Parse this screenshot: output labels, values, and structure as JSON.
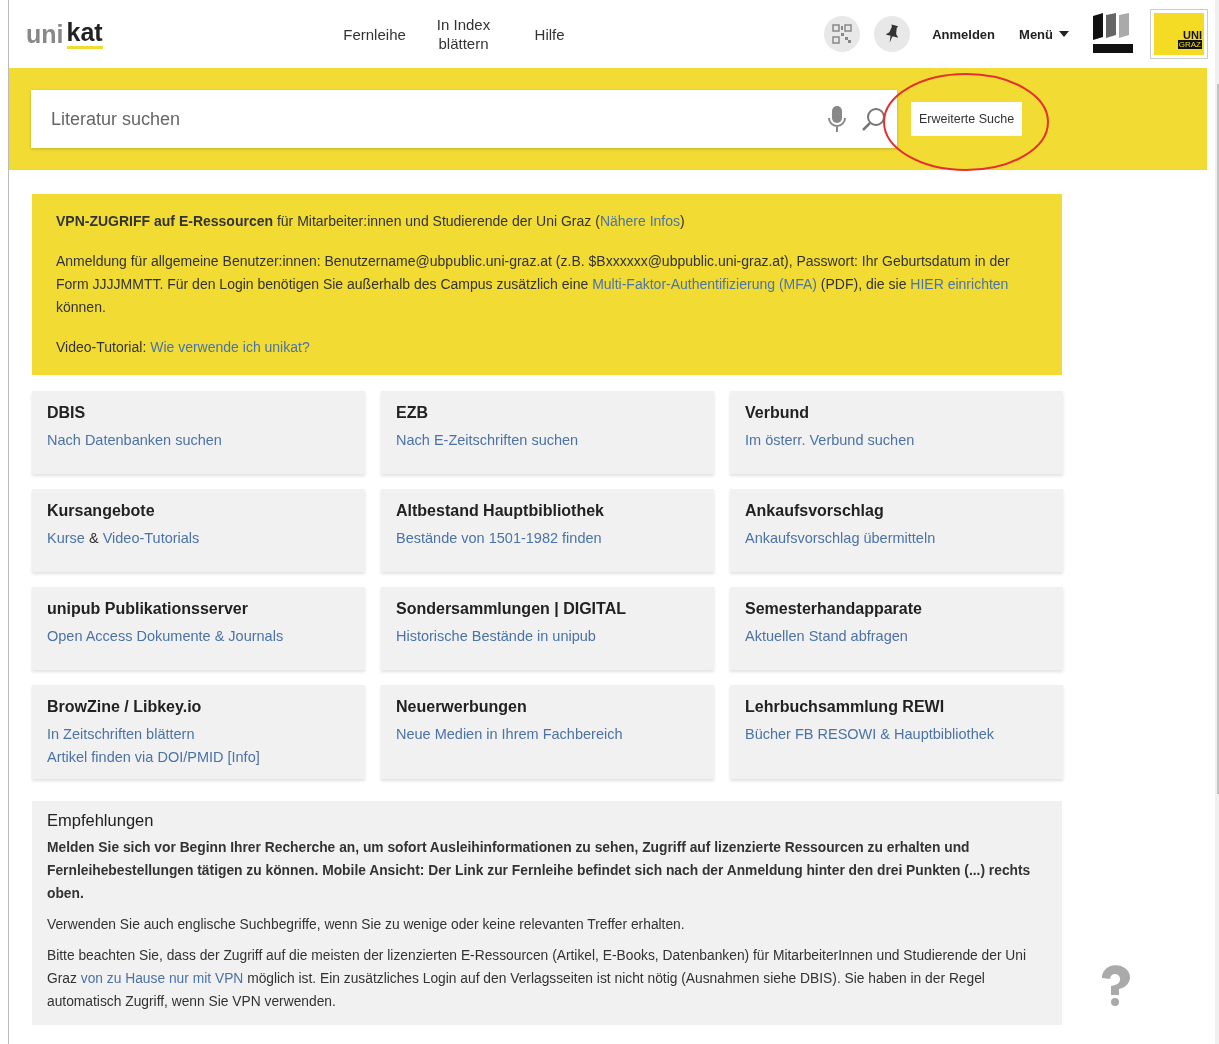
{
  "header": {
    "logo": {
      "first": "uni",
      "second": "kat"
    },
    "nav": [
      "Fernleihe",
      "In Index blättern",
      "Hilfe"
    ],
    "login": "Anmelden",
    "menu": "Menü",
    "uni_logo": {
      "top": "UNI",
      "bottom": "GRAZ"
    }
  },
  "search": {
    "placeholder": "Literatur suchen",
    "advanced": "Erweiterte Suche",
    "advanced_circled": true
  },
  "notice": {
    "paragraphs": [
      [
        {
          "kind": "text",
          "text": "**VPN-ZUGRIFF auf E-Ressourcen** für Mitarbeiter:innen und Studierende der Uni Graz ("
        },
        {
          "kind": "link",
          "text": "Nähere Infos"
        },
        {
          "kind": "text",
          "text": ")"
        }
      ],
      [
        {
          "kind": "text",
          "text": "Anmeldung für allgemeine Benutzer:innen: Benutzername@ubpublic.uni-graz.at (z.B. $Bxxxxxx@ubpublic.uni-graz.at), Passwort: Ihr Geburtsdatum in der Form JJJJMMTT. Für den Login benötigen Sie außerhalb des Campus zusätzlich eine "
        },
        {
          "kind": "link",
          "text": "Multi-Faktor-Authentifizierung (MFA)"
        },
        {
          "kind": "text",
          "text": " (PDF), die sie "
        },
        {
          "kind": "link",
          "text": "HIER einrichten"
        },
        {
          "kind": "text",
          "text": " können."
        }
      ],
      [
        {
          "kind": "text",
          "text": "Video-Tutorial: "
        },
        {
          "kind": "link",
          "text": "Wie verwende ich unikat?"
        }
      ]
    ]
  },
  "tiles": [
    {
      "title": "DBIS",
      "lines": [
        [
          {
            "kind": "link",
            "text": "Nach Datenbanken suchen"
          }
        ]
      ]
    },
    {
      "title": "EZB",
      "lines": [
        [
          {
            "kind": "link",
            "text": "Nach E-Zeitschriften suchen"
          }
        ]
      ]
    },
    {
      "title": "Verbund",
      "lines": [
        [
          {
            "kind": "link",
            "text": "Im österr. Verbund suchen"
          }
        ]
      ]
    },
    {
      "title": "Kursangebote",
      "lines": [
        [
          {
            "kind": "link",
            "text": "Kurse"
          },
          {
            "kind": "text",
            "text": " & "
          },
          {
            "kind": "link",
            "text": "Video-Tutorials"
          }
        ]
      ]
    },
    {
      "title": "Altbestand Hauptbibliothek",
      "lines": [
        [
          {
            "kind": "link",
            "text": "Bestände von 1501-1982 finden"
          }
        ]
      ]
    },
    {
      "title": "Ankaufsvorschlag",
      "lines": [
        [
          {
            "kind": "link",
            "text": "Ankaufsvorschlag übermitteln"
          }
        ]
      ]
    },
    {
      "title": "unipub Publikationsserver",
      "lines": [
        [
          {
            "kind": "link",
            "text": "Open Access Dokumente & Journals"
          }
        ]
      ]
    },
    {
      "title": "Sondersammlungen | DIGITAL",
      "lines": [
        [
          {
            "kind": "link",
            "text": "Historische Bestände in unipub"
          }
        ]
      ]
    },
    {
      "title": "Semesterhandapparate",
      "lines": [
        [
          {
            "kind": "link",
            "text": "Aktuellen Stand abfragen"
          }
        ]
      ]
    },
    {
      "title": "BrowZine / Libkey.io",
      "lines": [
        [
          {
            "kind": "link",
            "text": "In Zeitschriften blättern"
          }
        ],
        [
          {
            "kind": "link",
            "text": "Artikel finden via DOI/PMID"
          },
          {
            "kind": "link",
            "text": "[Info]"
          }
        ]
      ]
    },
    {
      "title": "Neuerwerbungen",
      "lines": [
        [
          {
            "kind": "link",
            "text": "Neue Medien in Ihrem Fachbereich"
          }
        ]
      ]
    },
    {
      "title": "Lehrbuchsammlung REWI",
      "lines": [
        [
          {
            "kind": "link",
            "text": "Bücher FB RESOWI & Hauptbibliothek"
          }
        ]
      ]
    }
  ],
  "recommendations": {
    "title": "Empfehlungen",
    "paragraphs": [
      [
        {
          "kind": "text",
          "text": "**Melden Sie sich vor Beginn Ihrer Recherche an, um sofort Ausleihinformationen zu sehen, Zugriff auf lizenzierte Ressourcen zu erhalten und Fernleihebestellungen tätigen zu können. Mobile Ansicht: Der Link zur Fernleihe befindet sich nach der Anmeldung hinter den drei Punkten (...) rechts oben.**"
        }
      ],
      [
        {
          "kind": "text",
          "text": "Verwenden Sie auch englische Suchbegriffe, wenn Sie zu wenige oder keine relevanten Treffer erhalten."
        }
      ],
      [
        {
          "kind": "text",
          "text": "Bitte beachten Sie, dass der Zugriff auf die meisten der lizenzierten E-Ressourcen (Artikel, E-Books, Datenbanken) für MitarbeiterInnen und Studierende der Uni Graz "
        },
        {
          "kind": "link",
          "text": "von zu Hause nur mit VPN"
        },
        {
          "kind": "text",
          "text": " möglich ist. Ein zusätzliches Login auf den Verlagsseiten ist nicht nötig (Ausnahmen siehe DBIS). Sie haben in der Regel automatisch Zugriff, wenn Sie VPN verwenden."
        }
      ]
    ]
  }
}
